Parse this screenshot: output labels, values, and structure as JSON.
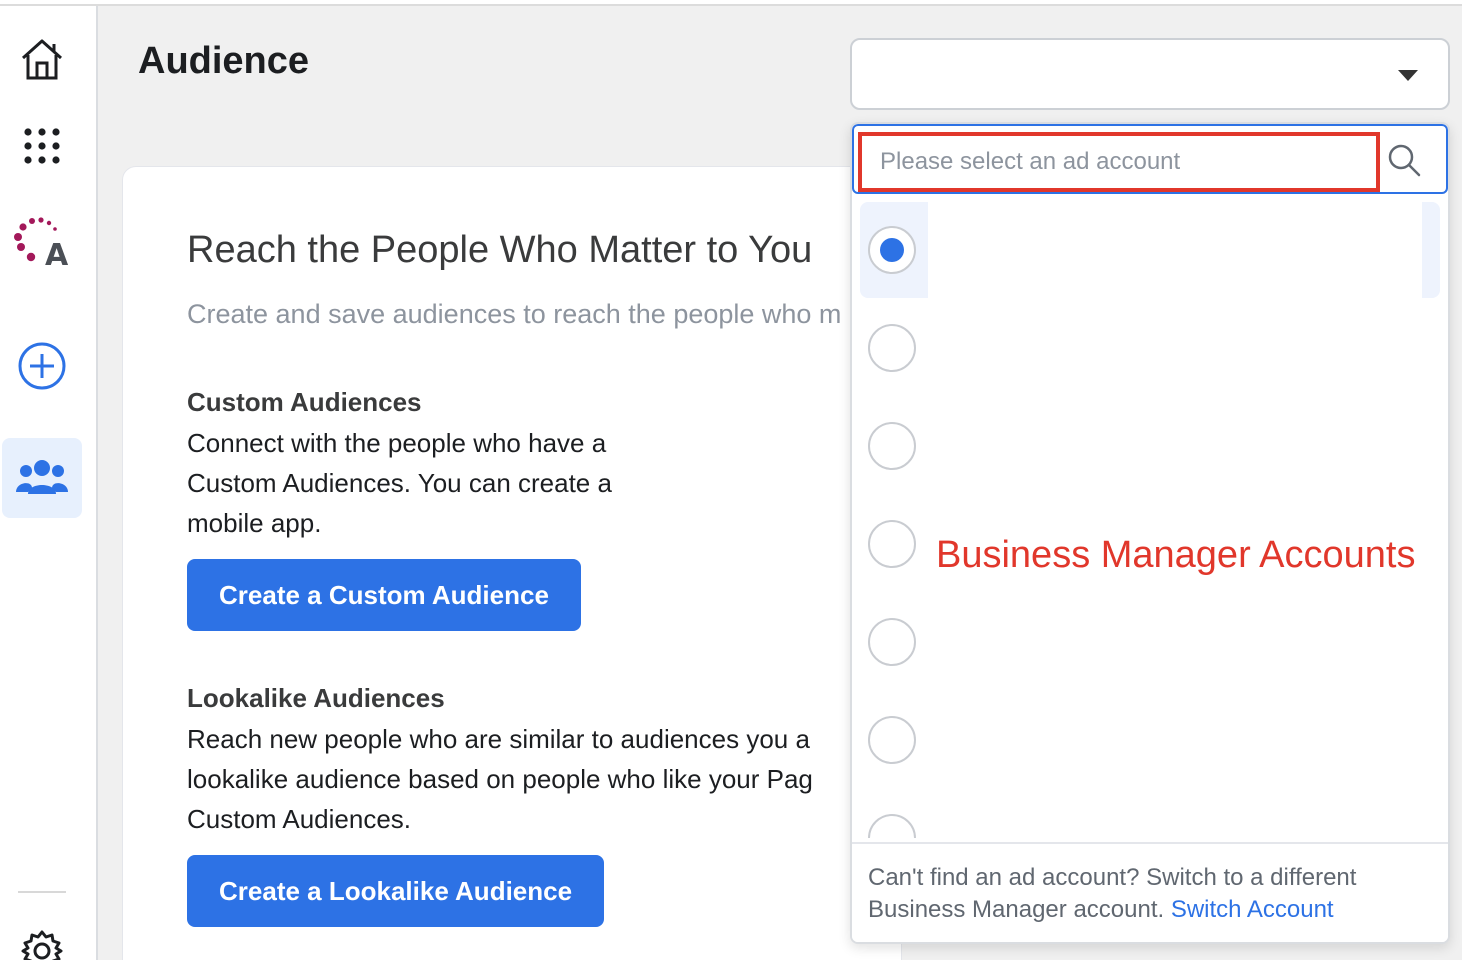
{
  "page": {
    "title": "Audience"
  },
  "sidebar": {
    "items": [
      {
        "name": "home-icon"
      },
      {
        "name": "apps-grid-icon"
      },
      {
        "name": "account-logo"
      },
      {
        "name": "add-icon"
      },
      {
        "name": "audiences-icon"
      },
      {
        "name": "gear-icon"
      }
    ]
  },
  "card": {
    "title": "Reach the People Who Matter to You",
    "subtitle": "Create and save audiences to reach the people who m",
    "custom": {
      "heading": "Custom Audiences",
      "line1": "Connect with the people who have a",
      "line2": "Custom Audiences. You can create a",
      "line3": "mobile app.",
      "button": "Create a Custom Audience"
    },
    "lookalike": {
      "heading": "Lookalike Audiences",
      "line1": "Reach new people who are similar to audiences you a",
      "line2": "lookalike audience based on people who like your Pag",
      "line3": "Custom Audiences.",
      "button": "Create a Lookalike Audience"
    }
  },
  "account_select": {
    "value": "",
    "search_placeholder": "Please select an ad account",
    "annotation": "Business Manager Accounts",
    "options": [
      {
        "label": "",
        "selected": true
      },
      {
        "label": "",
        "selected": false
      },
      {
        "label": "",
        "selected": false
      },
      {
        "label": "",
        "selected": false
      },
      {
        "label": "",
        "selected": false
      },
      {
        "label": "",
        "selected": false
      },
      {
        "label": "",
        "selected": false
      }
    ],
    "footer_text": "Can't find an ad account? Switch to a different Business Manager account.",
    "footer_link": "Switch Account"
  },
  "colors": {
    "accent": "#2d72e5",
    "annotation_red": "#e1372b"
  }
}
